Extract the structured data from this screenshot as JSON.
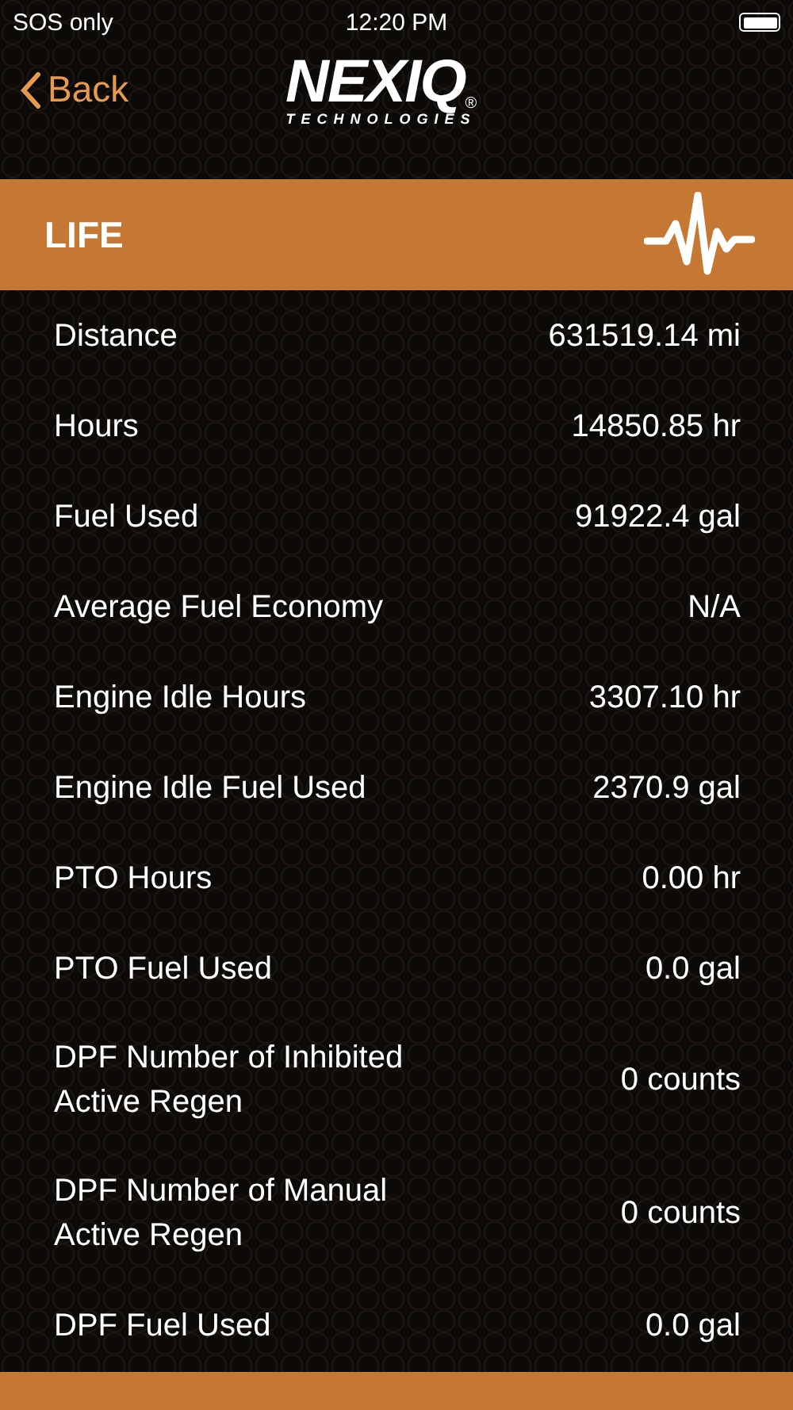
{
  "status_bar": {
    "carrier": "SOS only",
    "time": "12:20 PM"
  },
  "nav": {
    "back": "Back",
    "logo": {
      "name": "NEXIQ",
      "registered": "®",
      "subtitle": "TECHNOLOGIES"
    }
  },
  "section": {
    "title": "LIFE"
  },
  "rows": [
    {
      "label": "Distance",
      "value": "631519.14 mi"
    },
    {
      "label": "Hours",
      "value": "14850.85 hr"
    },
    {
      "label": "Fuel Used",
      "value": "91922.4 gal"
    },
    {
      "label": "Average Fuel Economy",
      "value": "N/A"
    },
    {
      "label": "Engine Idle Hours",
      "value": "3307.10 hr"
    },
    {
      "label": "Engine Idle Fuel Used",
      "value": "2370.9 gal"
    },
    {
      "label": "PTO Hours",
      "value": "0.00 hr"
    },
    {
      "label": "PTO Fuel Used",
      "value": "0.0 gal"
    },
    {
      "label": "DPF Number of Inhibited Active Regen",
      "value": "0 counts"
    },
    {
      "label": "DPF Number of Manual Active Regen",
      "value": "0 counts"
    },
    {
      "label": "DPF Fuel Used",
      "value": "0.0 gal"
    }
  ]
}
